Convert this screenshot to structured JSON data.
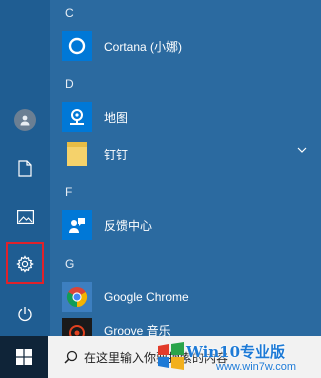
{
  "groups": [
    {
      "letter": "C",
      "apps": [
        {
          "name": "Cortana (小娜)",
          "icon": "cortana-icon"
        }
      ]
    },
    {
      "letter": "D",
      "apps": [
        {
          "name": "地图",
          "icon": "maps-icon"
        },
        {
          "name": "钉钉",
          "icon": "folder-icon",
          "expandable": true
        }
      ]
    },
    {
      "letter": "F",
      "apps": [
        {
          "name": "反馈中心",
          "icon": "feedback-hub-icon"
        }
      ]
    },
    {
      "letter": "G",
      "apps": [
        {
          "name": "Google Chrome",
          "icon": "chrome-icon"
        },
        {
          "name": "Groove 音乐",
          "icon": "groove-music-icon"
        }
      ]
    }
  ],
  "rail": {
    "items": [
      "user-icon",
      "documents-icon",
      "pictures-icon",
      "settings-icon",
      "power-icon"
    ],
    "highlighted": "settings-icon",
    "highlight_color": "#e0222a"
  },
  "taskbar": {
    "search_placeholder": "在这里输入你要搜索的内容"
  },
  "watermark": {
    "title": "Win10专业版",
    "url": "www.win7w.com"
  },
  "colors": {
    "background": "#2b6aa0",
    "rail": "#1f5d92",
    "tile": "#0078d7",
    "taskbar": "#0f2438",
    "folder": "#f5d26b"
  }
}
